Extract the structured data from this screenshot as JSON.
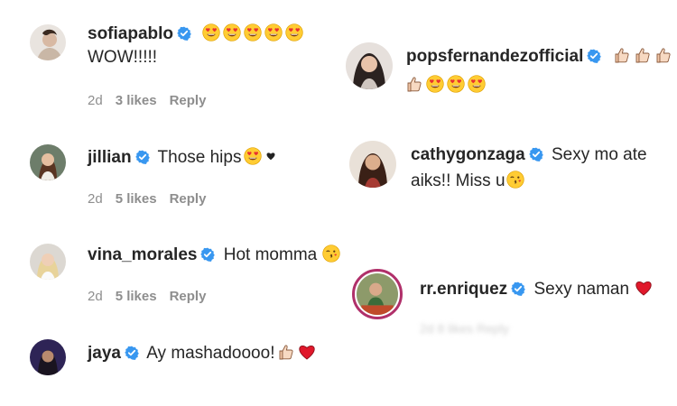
{
  "comments_left": [
    {
      "user": "sofiapablo",
      "text": "WOW!!!!!",
      "emojis": [
        "heart-eyes-emoji",
        "heart-eyes-emoji",
        "heart-eyes-emoji",
        "heart-eyes-emoji",
        "heart-eyes-emoji"
      ],
      "time": "2d",
      "likes": "3 likes",
      "reply": "Reply"
    },
    {
      "user": "jillian",
      "text": "Those hips",
      "emojis": [
        "heart-eyes-emoji",
        "black-heart-emoji"
      ],
      "time": "2d",
      "likes": "5 likes",
      "reply": "Reply"
    },
    {
      "user": "vina_morales",
      "text": "Hot momma",
      "emojis": [
        "kissing-wink-emoji"
      ],
      "time": "2d",
      "likes": "5 likes",
      "reply": "Reply"
    },
    {
      "user": "jaya",
      "text": "Ay mashadoooo!",
      "emojis": [
        "thumbs-up-emoji",
        "red-heart-emoji"
      ]
    }
  ],
  "comments_right": [
    {
      "user": "popsfernandezofficial",
      "emojis_line1": [
        "thumbs-up-emoji",
        "thumbs-up-emoji",
        "thumbs-up-emoji"
      ],
      "emojis_line2": [
        "thumbs-up-emoji",
        "heart-eyes-emoji",
        "heart-eyes-emoji",
        "heart-eyes-emoji"
      ]
    },
    {
      "user": "cathygonzaga",
      "text_line1": "Sexy mo ate",
      "text_line2": "aiks!! Miss u",
      "emojis": [
        "kissing-wink-emoji"
      ]
    },
    {
      "user": "rr.enriquez",
      "text": "Sexy naman",
      "emojis": [
        "red-heart-emoji"
      ],
      "blurred_meta": "2d  8 likes  Reply"
    }
  ],
  "colors": {
    "verified": "#3897f0",
    "meta": "#8e8e8e",
    "username": "#262626"
  }
}
